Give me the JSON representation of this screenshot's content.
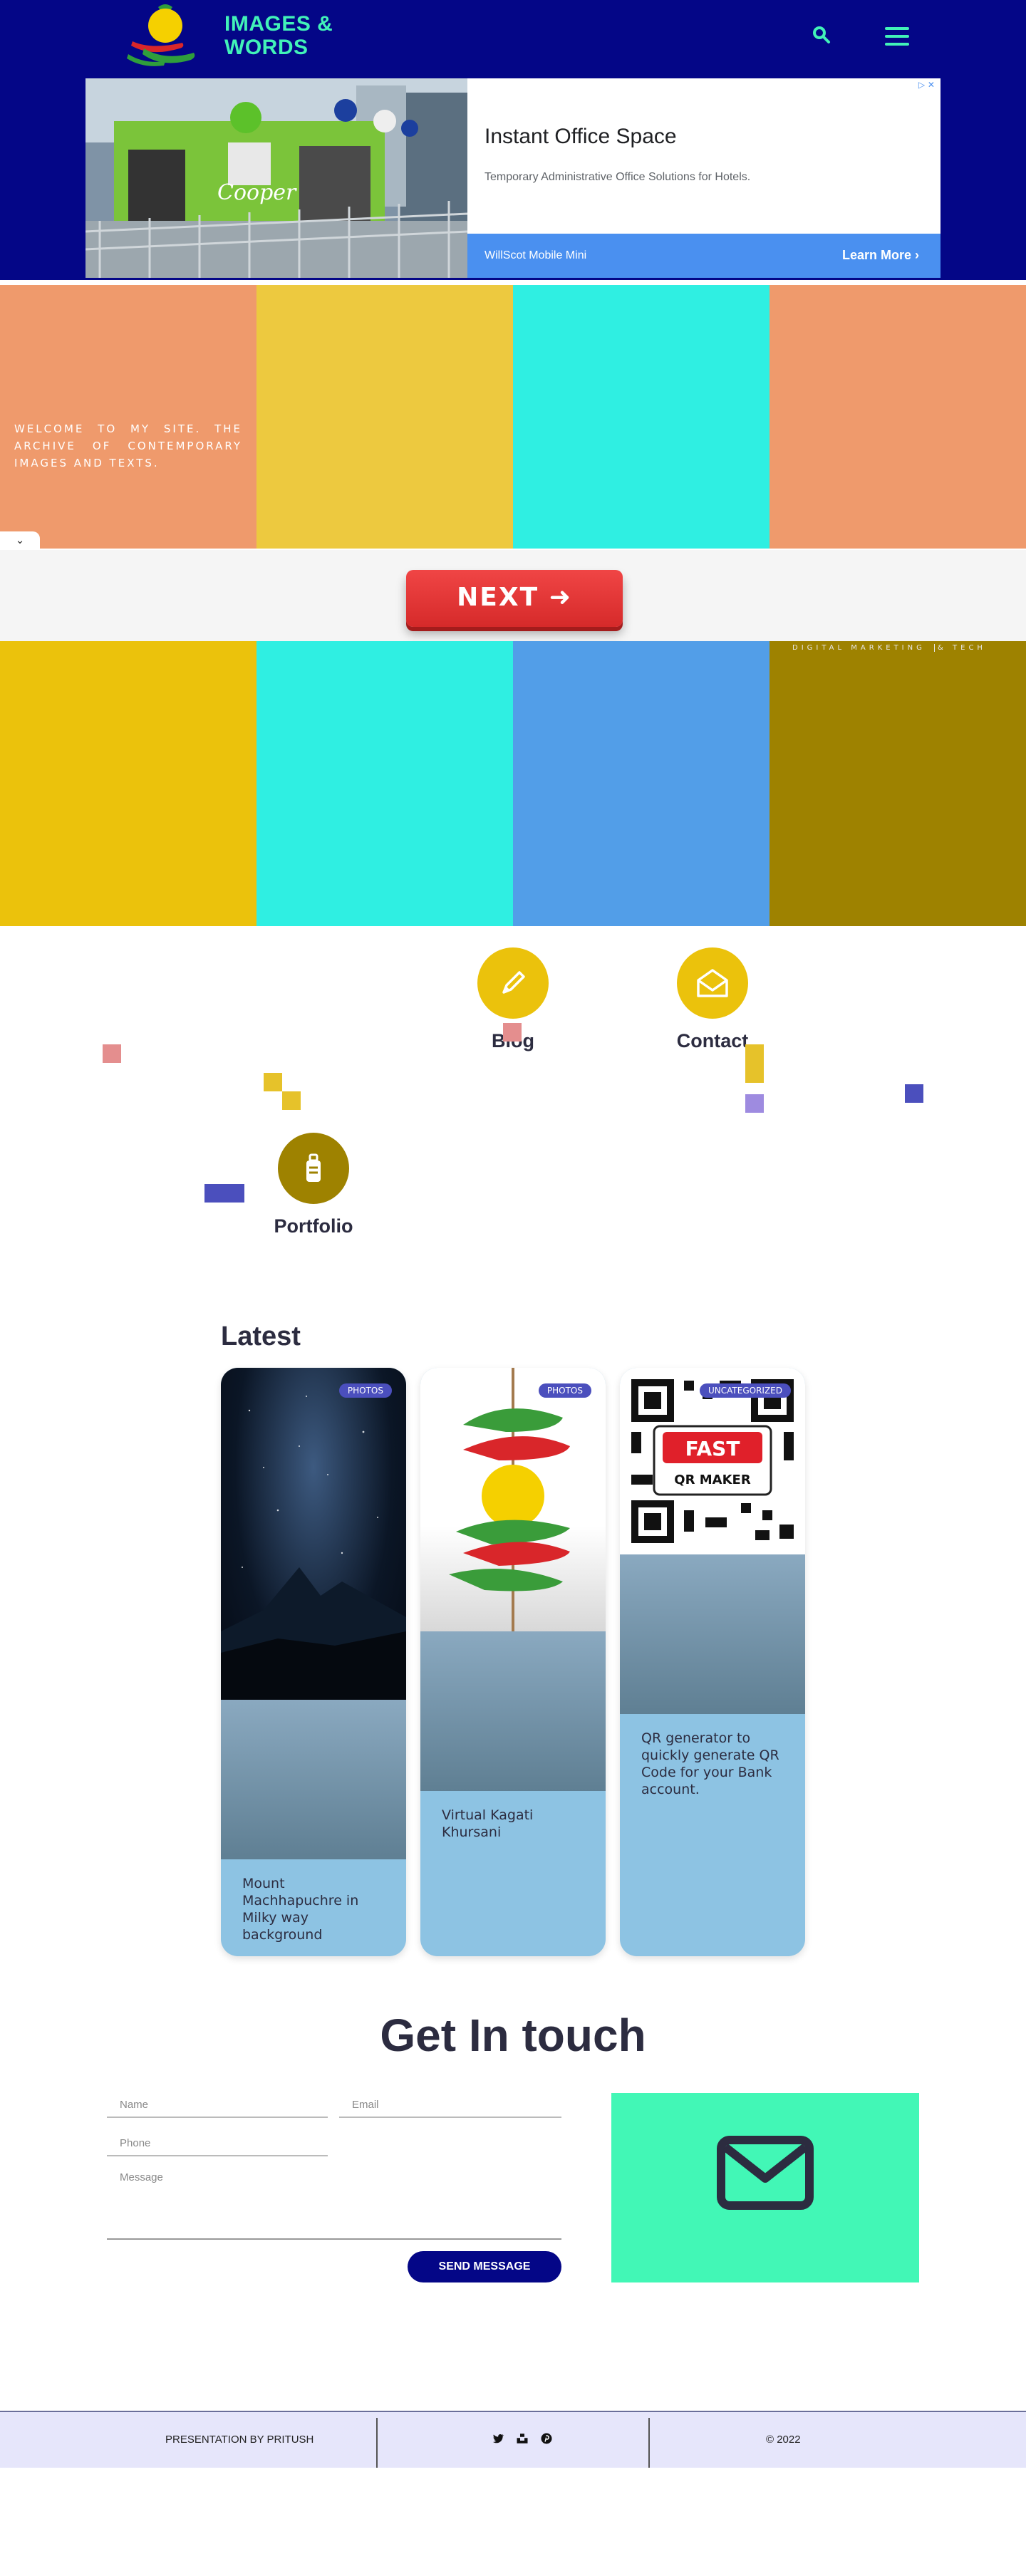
{
  "header": {
    "logo_line1": "IMAGES &",
    "logo_line2": "WORDS",
    "search_icon": "search-icon",
    "menu_icon": "hamburger-icon"
  },
  "ad": {
    "title": "Instant Office Space",
    "description": "Temporary Administrative Office Solutions for Hotels.",
    "advertiser": "WillScot Mobile Mini",
    "cta": "Learn More",
    "image_sign": "Cooper",
    "choices_icon": "adchoices-icon"
  },
  "hero": {
    "welcome_text": "Welcome to my site. The archive of contemporary images and texts.",
    "tile_colors_top": [
      "#ef9a6c",
      "#edc93f",
      "#2fefe2",
      "#ef9a6c"
    ],
    "tile_colors_bottom": [
      "#ebc20c",
      "#2fefe2",
      "#529ee8",
      "#9e8200"
    ],
    "next_label": "NEXT ➜",
    "tag_left": "DIGITAL MARKETING",
    "tag_right": "& TECH"
  },
  "nav": {
    "blog_label": "Blog",
    "contact_label": "Contact",
    "portfolio_label": "Portfolio",
    "blog_color": "#ebc20c",
    "contact_color": "#ebc20c",
    "portfolio_color": "#9e8200"
  },
  "latest": {
    "heading": "Latest",
    "cards": [
      {
        "category": "PHOTOS",
        "title": "Mount Machhapuchre in Milky way background"
      },
      {
        "category": "PHOTOS",
        "title": "Virtual Kagati Khursani"
      },
      {
        "category": "UNCATEGORIZED",
        "title": "QR generator to quickly generate QR Code for your Bank account.",
        "qr_line1": "FAST",
        "qr_line2": "QR MAKER"
      }
    ]
  },
  "contact": {
    "heading": "Get In touch",
    "name_placeholder": "Name",
    "email_placeholder": "Email",
    "phone_placeholder": "Phone",
    "message_placeholder": "Message",
    "send_label": "SEND MESSAGE",
    "accent": "#42f7b6"
  },
  "footer": {
    "credit": "PRESENTATION BY PRITUSH",
    "copyright": "© 2022",
    "social_icons": [
      "twitter-icon",
      "unsplash-icon",
      "pinterest-icon"
    ]
  }
}
